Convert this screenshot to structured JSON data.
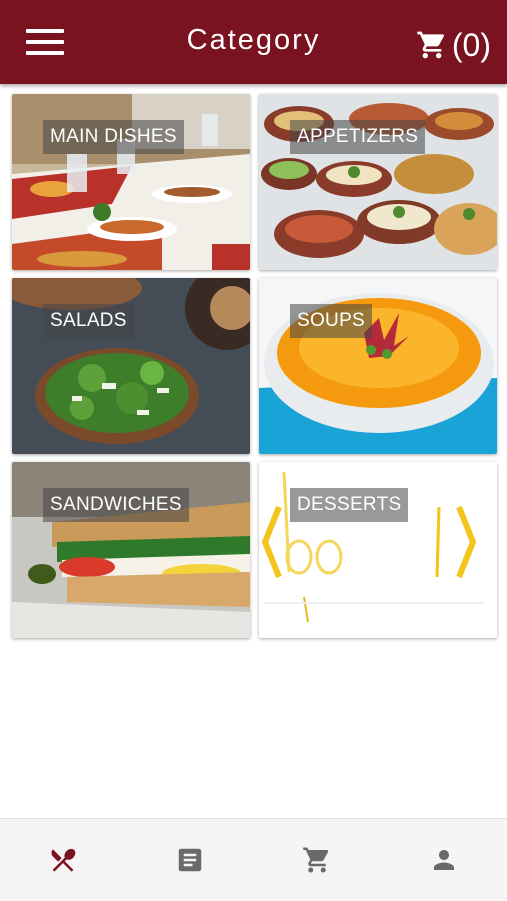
{
  "header": {
    "title": "Category",
    "cart_label": "(0)",
    "menu_icon": "hamburger-menu-icon",
    "cart_icon": "shopping-cart-icon"
  },
  "categories": [
    {
      "label": "MAIN DISHES"
    },
    {
      "label": "APPETIZERS"
    },
    {
      "label": "SALADS"
    },
    {
      "label": "SOUPS"
    },
    {
      "label": "SANDWICHES"
    },
    {
      "label": "DESSERTS"
    }
  ],
  "bottom_nav": [
    {
      "icon": "utensils-icon",
      "active": true
    },
    {
      "icon": "orders-list-icon",
      "active": false
    },
    {
      "icon": "cart-icon",
      "active": false
    },
    {
      "icon": "profile-icon",
      "active": false
    }
  ],
  "colors": {
    "brand": "#7a1320",
    "nav_inactive": "#6a6a6a",
    "background": "#ffffff"
  }
}
